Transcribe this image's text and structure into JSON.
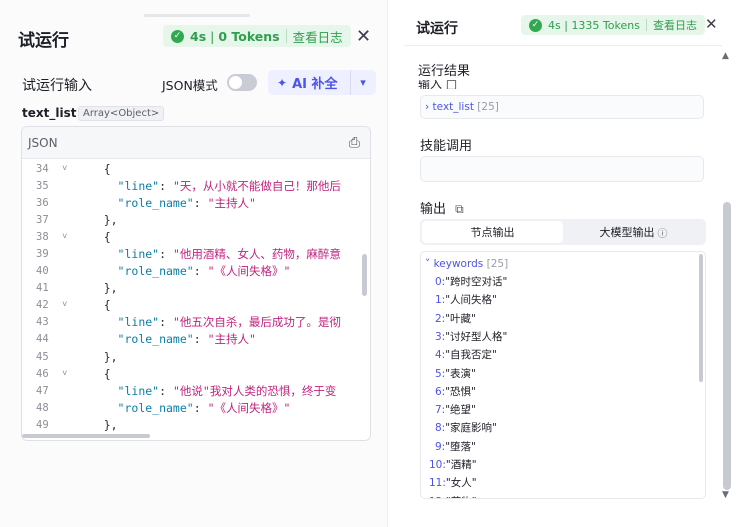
{
  "left": {
    "title": "试运行",
    "badge": {
      "time": "4s",
      "tokens": "0 Tokens",
      "log": "查看日志"
    },
    "input_title": "试运行输入",
    "json_mode": "JSON模式",
    "ai_button": "AI 补全",
    "field_name": "text_list",
    "field_type": "Array<Object>",
    "editor_lang": "JSON",
    "code_lines": [
      {
        "n": "34",
        "fold": true,
        "html": "  {"
      },
      {
        "n": "35",
        "fold": false,
        "key": "line",
        "val": "天，从小就不能做自己！那他后"
      },
      {
        "n": "36",
        "fold": false,
        "key": "role_name",
        "val": "主持人\""
      },
      {
        "n": "37",
        "fold": false,
        "html": "  },"
      },
      {
        "n": "38",
        "fold": true,
        "html": "  {"
      },
      {
        "n": "39",
        "fold": false,
        "key": "line",
        "val": "他用酒精、女人、药物，麻醉意"
      },
      {
        "n": "40",
        "fold": false,
        "key": "role_name",
        "val": "《人间失格》\""
      },
      {
        "n": "41",
        "fold": false,
        "html": "  },"
      },
      {
        "n": "42",
        "fold": true,
        "html": "  {"
      },
      {
        "n": "43",
        "fold": false,
        "key": "line",
        "val": "他五次自杀，最后成功了。是彻"
      },
      {
        "n": "44",
        "fold": false,
        "key": "role_name",
        "val": "主持人\""
      },
      {
        "n": "45",
        "fold": false,
        "html": "  },"
      },
      {
        "n": "46",
        "fold": true,
        "html": "  {"
      },
      {
        "n": "47",
        "fold": false,
        "key": "line",
        "val": "他说\"我对人类的恐惧，终于变"
      },
      {
        "n": "48",
        "fold": false,
        "key": "role_name",
        "val": "《人间失格》\""
      },
      {
        "n": "49",
        "fold": false,
        "html": "  },"
      }
    ]
  },
  "right": {
    "title": "试运行",
    "badge": {
      "time": "4s",
      "tokens": "1335 Tokens",
      "log": "查看日志"
    },
    "results_title": "运行结果",
    "input_partial": "输入 □",
    "text_list_label": "text_list",
    "text_list_count": "[25]",
    "skill_title": "技能调用",
    "output_title": "输出",
    "tab_node": "节点输出",
    "tab_llm": "大模型输出",
    "keywords_label": "keywords",
    "keywords_count": "[25]",
    "keywords": [
      "跨时空对话",
      "人间失格",
      "叶藏",
      "讨好型人格",
      "自我否定",
      "表演",
      "恐惧",
      "绝望",
      "家庭影响",
      "堕落",
      "酒精",
      "女人",
      "药物"
    ]
  }
}
